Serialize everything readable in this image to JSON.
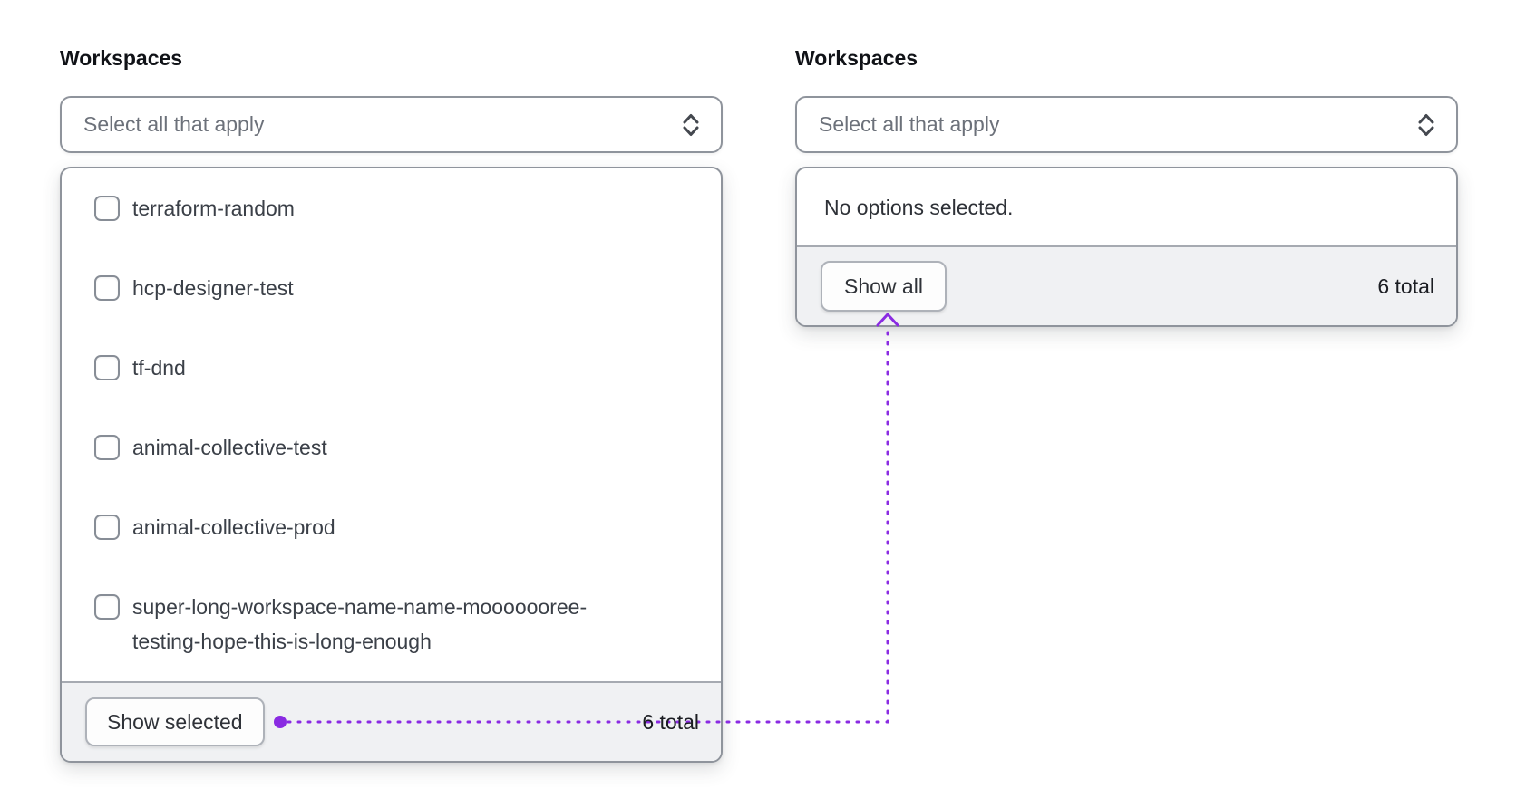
{
  "annotation": {
    "color": "#8a2be2"
  },
  "left_combobox": {
    "label": "Workspaces",
    "placeholder": "Select all that apply",
    "options": [
      {
        "label": "terraform-random",
        "checked": false
      },
      {
        "label": "hcp-designer-test",
        "checked": false
      },
      {
        "label": "tf-dnd",
        "checked": false
      },
      {
        "label": "animal-collective-test",
        "checked": false
      },
      {
        "label": "animal-collective-prod",
        "checked": false
      },
      {
        "label": "super-long-workspace-name-name-mooooooree-testing-hope-this-is-long-enough",
        "checked": false
      }
    ],
    "footer": {
      "button": "Show selected",
      "total": "6 total"
    }
  },
  "right_combobox": {
    "label": "Workspaces",
    "placeholder": "Select all that apply",
    "empty_message": "No options selected.",
    "footer": {
      "button": "Show all",
      "total": "6 total"
    }
  }
}
